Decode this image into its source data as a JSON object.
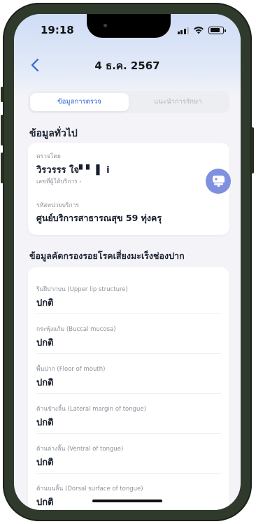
{
  "status_bar": {
    "time": "19:18"
  },
  "nav": {
    "back_icon": "chevron-left-icon",
    "title": "4 ธ.ค. 2567"
  },
  "tabs": [
    {
      "label": "ข้อมูลการตรวจ",
      "active": true
    },
    {
      "label": "แนะนำการรักษา",
      "active": false
    }
  ],
  "general": {
    "section_title": "ข้อมูลทั่วไป",
    "examined_by_label": "ตรวจโดย",
    "examiner_name": "วิรวรรร ใจ▘▘ ▌ i",
    "provider_id": "เลขที่ผู้ให้บริการ -",
    "unit_label": "รหัสหน่วยบริการ",
    "unit_name": "ศูนย์บริการสาธารณสุข 59 ทุ่งครุ",
    "avatar_icon": "dental-chair-icon"
  },
  "screening": {
    "section_title": "ข้อมูลคัดกรองรอยโรคเสี่ยงมะเร็งช่องปาก",
    "items": [
      {
        "label": "ริมฝีปากบน (Upper lip structure)",
        "value": "ปกติ"
      },
      {
        "label": "กระพุ้งแก้ม (Buccal mucosa)",
        "value": "ปกติ"
      },
      {
        "label": "พื้นปาก (Floor of mouth)",
        "value": "ปกติ"
      },
      {
        "label": "ด้านข้างลิ้น (Lateral margin of tongue)",
        "value": "ปกติ"
      },
      {
        "label": "ด้านล่างลิ้น (Ventral of tongue)",
        "value": "ปกติ"
      },
      {
        "label": "ด้านบนลิ้น (Dorsal surface of tongue)",
        "value": "ปกติ"
      }
    ]
  },
  "colors": {
    "accent": "#2f63d9",
    "avatar": "#7f90e0",
    "frame": "#2f3a2c"
  }
}
